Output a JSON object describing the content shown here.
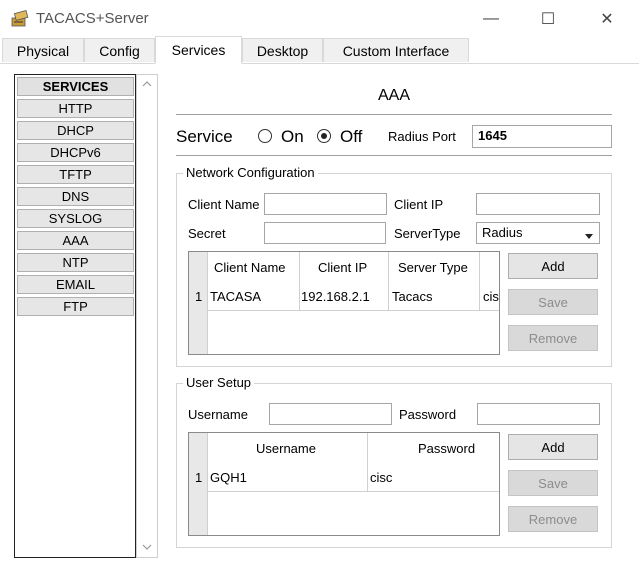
{
  "window": {
    "title": "TACACS+Server",
    "minimize": "—",
    "maximize": "☐",
    "close": "✕"
  },
  "tabs": [
    "Physical",
    "Config",
    "Services",
    "Desktop",
    "Custom Interface"
  ],
  "services": {
    "header": "SERVICES",
    "items": [
      "HTTP",
      "DHCP",
      "DHCPv6",
      "TFTP",
      "DNS",
      "SYSLOG",
      "AAA",
      "NTP",
      "EMAIL",
      "FTP"
    ]
  },
  "aaa": {
    "heading": "AAA",
    "service_label": "Service",
    "on_label": "On",
    "off_label": "Off",
    "service_state": "Off",
    "radius_port_label": "Radius Port",
    "radius_port_value": "1645"
  },
  "network": {
    "title": "Network Configuration",
    "client_name_label": "Client Name",
    "client_ip_label": "Client IP",
    "secret_label": "Secret",
    "server_type_label": "ServerType",
    "server_type_value": "Radius",
    "columns": [
      "Client Name",
      "Client IP",
      "Server Type"
    ],
    "rows": [
      {
        "index": "1",
        "client_name": "TACASA",
        "client_ip": "192.168.2.1",
        "server_type": "Tacacs",
        "key": "cis"
      }
    ],
    "add": "Add",
    "save": "Save",
    "remove": "Remove"
  },
  "users": {
    "title": "User Setup",
    "username_label": "Username",
    "password_label": "Password",
    "columns": [
      "Username",
      "Password"
    ],
    "rows": [
      {
        "index": "1",
        "username": "GQH1",
        "password": "cisc"
      }
    ],
    "add": "Add",
    "save": "Save",
    "remove": "Remove"
  }
}
